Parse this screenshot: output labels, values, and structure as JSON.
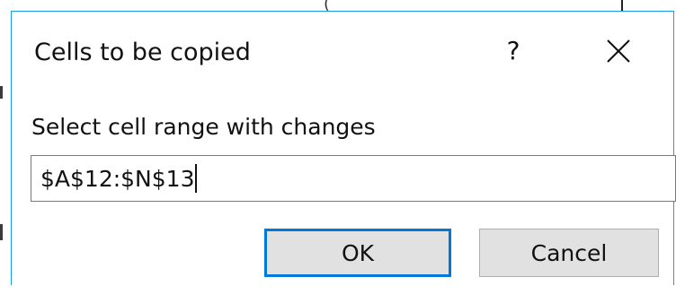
{
  "background": {
    "paren_fragment": "("
  },
  "dialog": {
    "title": "Cells to be copied",
    "help_label": "?",
    "prompt_label": "Select cell range with changes",
    "range_input_value": "$A$12:$N$13",
    "ok_label": "OK",
    "cancel_label": "Cancel",
    "accent_color": "#0078d7",
    "border_color": "#1ba1e2"
  }
}
